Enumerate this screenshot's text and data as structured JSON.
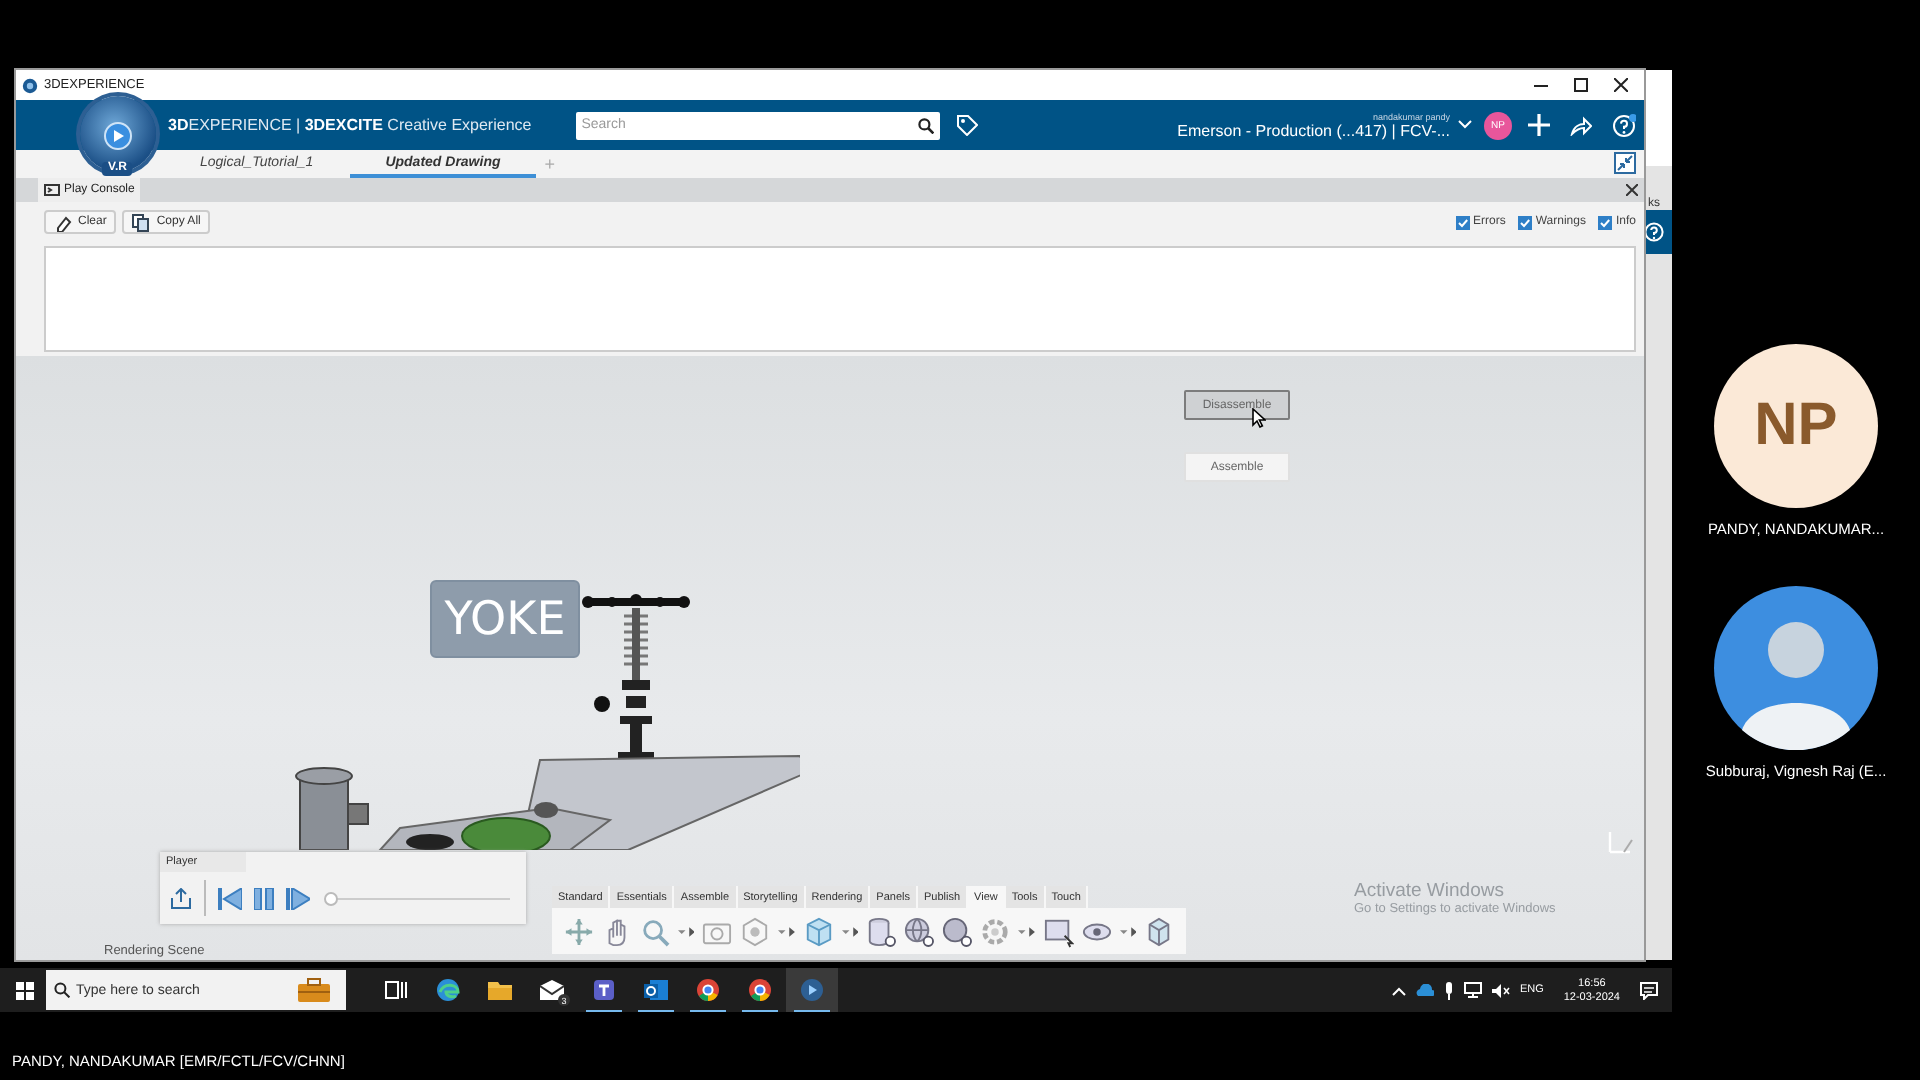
{
  "window": {
    "title": "3DEXPERIENCE"
  },
  "header": {
    "compass_label": "V.R",
    "brand": "**3D**EXPERIENCE | **3DEXCITE** Creative Experience",
    "search": {
      "placeholder": "Search"
    },
    "user_name": "nandakumar pandy",
    "context": "Emerson - Production (...417) | FCV-...",
    "avatar_initials": "NP"
  },
  "tabs": [
    {
      "label": "Logical_Tutorial_1",
      "selected": false
    },
    {
      "label": "Updated Drawing",
      "selected": true
    }
  ],
  "new_tab": "+",
  "console": {
    "title": "Play Console",
    "buttons": [
      "Clear",
      "Copy All"
    ],
    "filters": [
      {
        "label": "Errors",
        "checked": true
      },
      {
        "label": "Warnings",
        "checked": true
      },
      {
        "label": "Info",
        "checked": true
      }
    ]
  },
  "viewport": {
    "buttons": [
      {
        "label": "Disassemble",
        "hovered": true
      },
      {
        "label": "Assemble",
        "hovered": false
      }
    ],
    "part_label": "YOKE",
    "status": "Rendering Scene",
    "activation": {
      "title": "Activate Windows",
      "subtitle": "Go to Settings to activate Windows"
    }
  },
  "player": {
    "title": "Player",
    "level": 0
  },
  "toolbar_tabs": [
    {
      "label": "Standard",
      "selected": false
    },
    {
      "label": "Essentials",
      "selected": false
    },
    {
      "label": "Assemble",
      "selected": false
    },
    {
      "label": "Storytelling",
      "selected": false
    },
    {
      "label": "Rendering",
      "selected": false
    },
    {
      "label": "Panels",
      "selected": false
    },
    {
      "label": "Publish",
      "selected": false
    },
    {
      "label": "View",
      "selected": true
    },
    {
      "label": "Tools",
      "selected": false
    },
    {
      "label": "Touch",
      "selected": false
    }
  ],
  "background_window": {
    "text": "ks"
  },
  "taskbar": {
    "search": {
      "placeholder": "Type here to search"
    },
    "apps": [
      {
        "kind": "taskview",
        "running": false,
        "selected": false
      },
      {
        "kind": "browser",
        "running": false,
        "selected": false
      },
      {
        "kind": "folder",
        "running": false,
        "selected": false
      },
      {
        "kind": "mail",
        "running": false,
        "selected": false,
        "badge": "3"
      },
      {
        "kind": "chat",
        "running": true,
        "selected": false
      },
      {
        "kind": "email",
        "running": true,
        "selected": false
      },
      {
        "kind": "chrome",
        "running": true,
        "selected": false
      },
      {
        "kind": "chrome",
        "running": true,
        "selected": false
      },
      {
        "kind": "cad",
        "running": true,
        "selected": true
      }
    ],
    "language": "ENG",
    "time": "16:56",
    "date": "12-03-2024"
  },
  "participants": [
    {
      "kind": "initials",
      "initials": "NP",
      "name": "PANDY, NANDAKUMAR..."
    },
    {
      "kind": "photo",
      "name": "Subburaj, Vignesh Raj (E..."
    }
  ],
  "presenter_caption": "PANDY, NANDAKUMAR [EMR/FCTL/FCV/CHNN]"
}
